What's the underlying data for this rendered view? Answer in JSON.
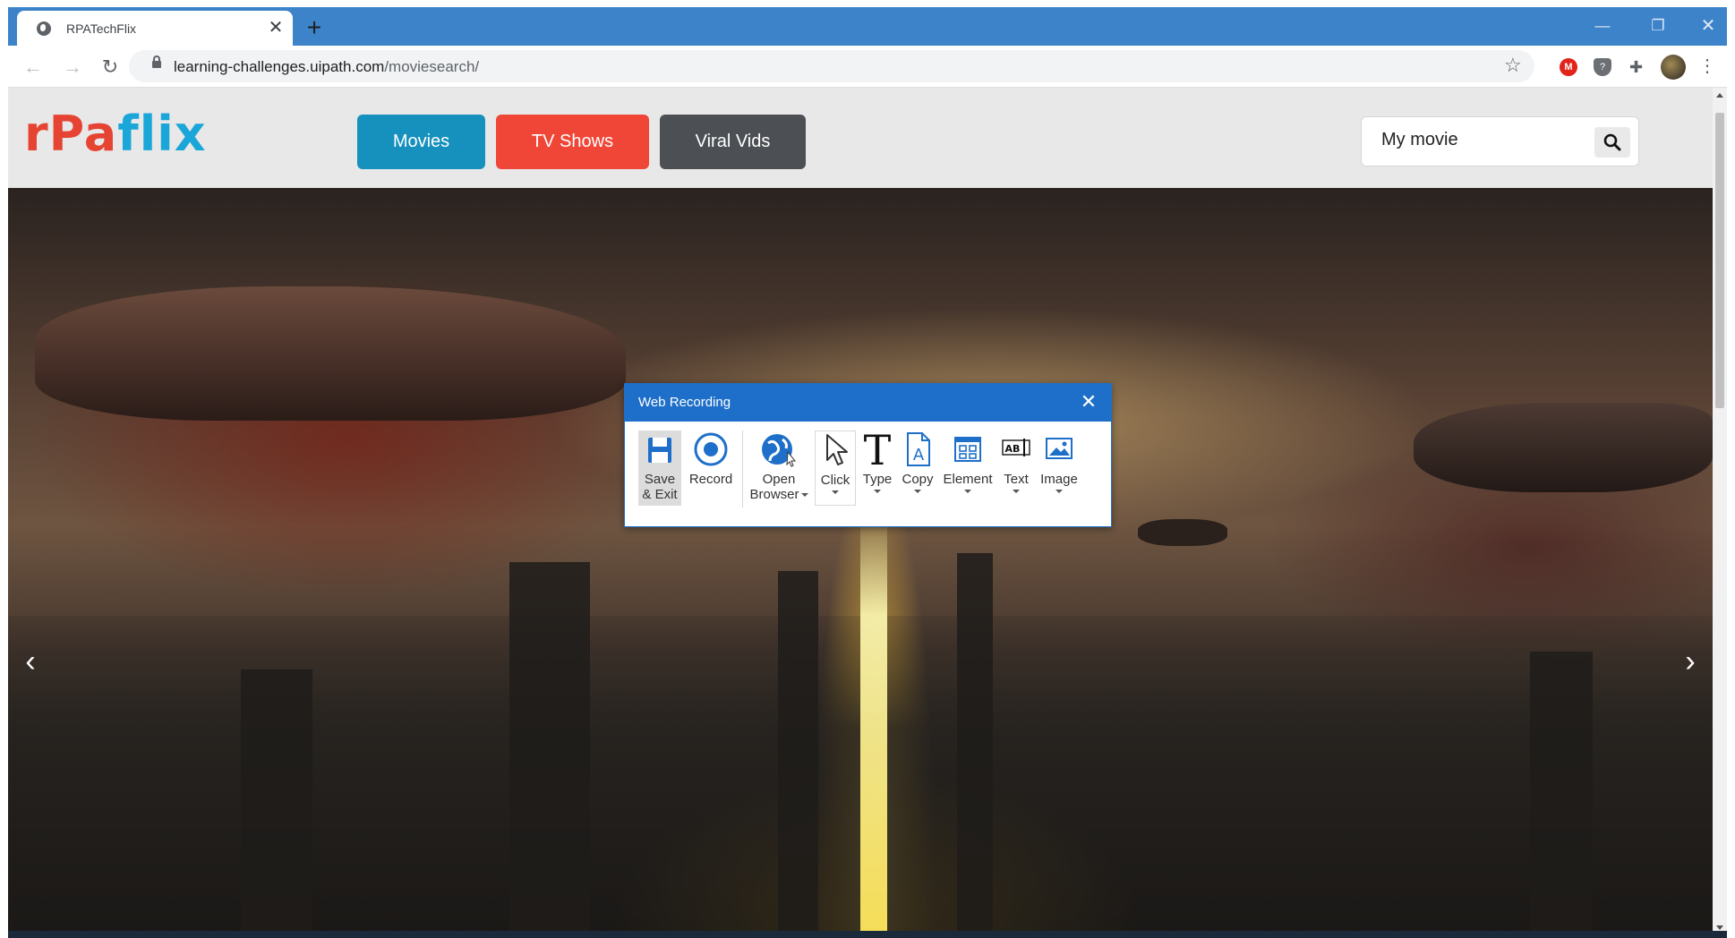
{
  "browser": {
    "tab_title": "RPATechFlix",
    "tab_close": "✕",
    "new_tab": "+",
    "url_host": "learning-challenges.uipath.com",
    "url_path": "/moviesearch/",
    "window_controls": {
      "minimize": "—",
      "maximize": "❐",
      "close": "✕"
    },
    "nav": {
      "back": "←",
      "forward": "→",
      "reload": "↻",
      "star": "☆",
      "menu": "⋮"
    },
    "extensions": {
      "m_label": "M",
      "shield_label": "?",
      "puzzle": "✚"
    }
  },
  "site": {
    "logo_part1": "rPa",
    "logo_part2": "flix",
    "nav": [
      {
        "label": "Movies",
        "color": "#1690bd"
      },
      {
        "label": "TV Shows",
        "color": "#f04637"
      },
      {
        "label": "Viral Vids",
        "color": "#4c5054"
      }
    ],
    "search": {
      "value": "My movie"
    },
    "carousel": {
      "prev": "‹",
      "next": "›"
    }
  },
  "recorder": {
    "title": "Web Recording",
    "close": "✕",
    "tools": {
      "save_line1": "Save",
      "save_line2": "& Exit",
      "record": "Record",
      "open_line1": "Open",
      "open_line2": "Browser",
      "click": "Click",
      "type": "Type",
      "copy": "Copy",
      "element": "Element",
      "text": "Text",
      "image": "Image"
    },
    "accent": "#1e6fc9"
  }
}
